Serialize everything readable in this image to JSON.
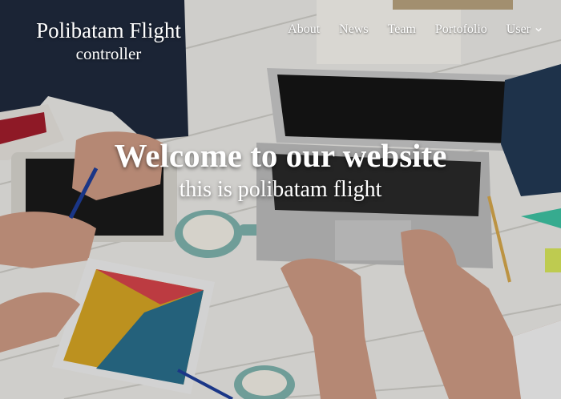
{
  "brand": {
    "line1": "Polibatam Flight",
    "line2": "controller"
  },
  "nav": {
    "about": "About",
    "news": "News",
    "team": "Team",
    "portfolio": "Portofolio",
    "user": "User"
  },
  "hero": {
    "title": "Welcome to our website",
    "subtitle": "this is polibatam flight"
  }
}
